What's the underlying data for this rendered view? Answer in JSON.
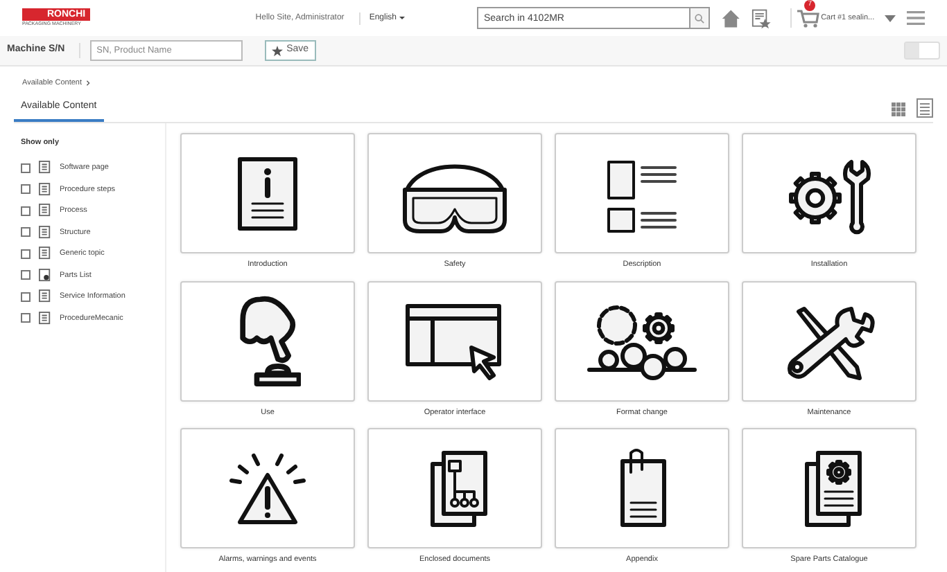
{
  "header": {
    "logo": {
      "brand": "RONCHI",
      "tagline": "PACKAGING MACHINERY"
    },
    "greeting": "Hello Site, Administrator",
    "language": "English",
    "search": {
      "placeholder": "Search in 4102MR"
    },
    "cart": {
      "count": "7",
      "label": "Cart #1 sealin..."
    }
  },
  "toolbar": {
    "label": "Machine S/N",
    "field": {
      "placeholder": "SN, Product Name"
    },
    "save": "Save",
    "toggle": {
      "on": false
    }
  },
  "breadcrumb": [
    "Available Content"
  ],
  "tabs": [
    {
      "label": "Available Content",
      "selected": true
    }
  ],
  "filters": {
    "title": "Show only",
    "items": [
      {
        "label": "Software page",
        "kind": "page",
        "checked": false
      },
      {
        "label": "Procedure steps",
        "kind": "page",
        "checked": false
      },
      {
        "label": "Process",
        "kind": "page",
        "checked": false
      },
      {
        "label": "Structure",
        "kind": "page",
        "checked": false
      },
      {
        "label": "Generic topic",
        "kind": "page",
        "checked": false
      },
      {
        "label": "Parts List",
        "kind": "parts",
        "checked": false
      },
      {
        "label": "Service Information",
        "kind": "page",
        "checked": false
      },
      {
        "label": "ProcedureMecanic",
        "kind": "page",
        "checked": false
      }
    ]
  },
  "cards": [
    {
      "label": "Introduction",
      "kind": "info"
    },
    {
      "label": "Safety",
      "kind": "goggles"
    },
    {
      "label": "Description",
      "kind": "list"
    },
    {
      "label": "Installation",
      "kind": "gear-wrench"
    },
    {
      "label": "Use",
      "kind": "press"
    },
    {
      "label": "Operator interface",
      "kind": "screen"
    },
    {
      "label": "Format change",
      "kind": "format"
    },
    {
      "label": "Maintenance",
      "kind": "tools"
    },
    {
      "label": "Alarms, warnings and events",
      "kind": "alarm"
    },
    {
      "label": "Enclosed documents",
      "kind": "diagram-docs"
    },
    {
      "label": "Appendix",
      "kind": "clip-doc"
    },
    {
      "label": "Spare Parts Catalogue",
      "kind": "gear-docs"
    }
  ]
}
